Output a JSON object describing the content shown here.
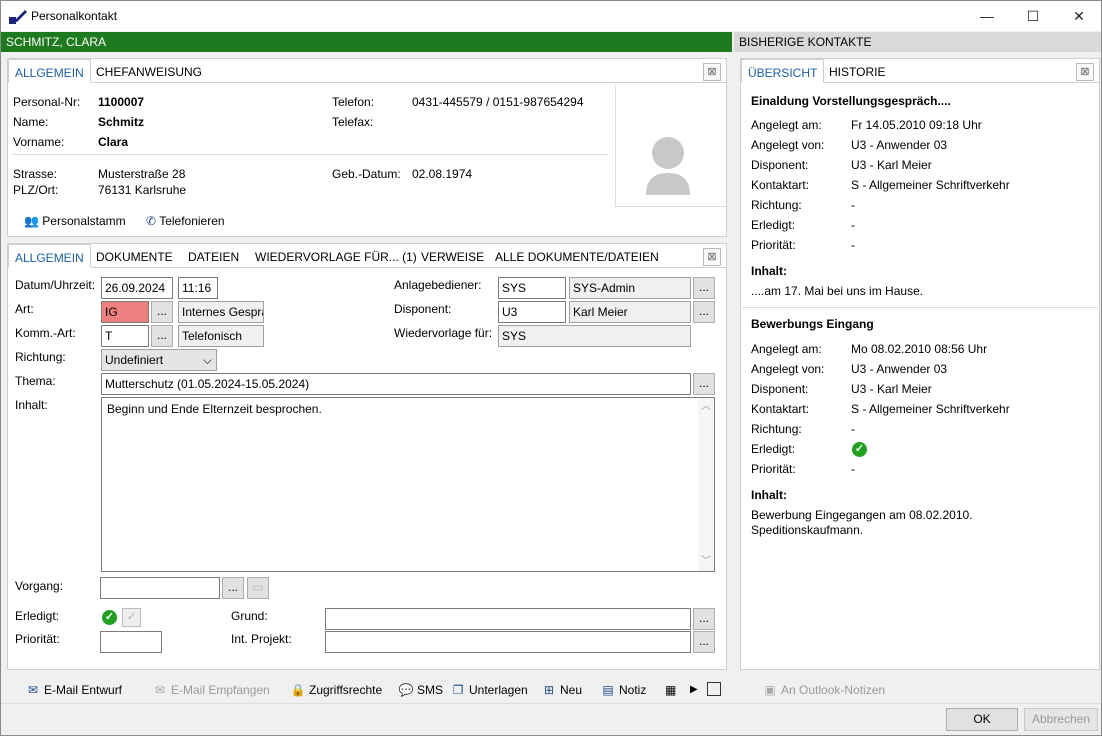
{
  "window": {
    "title": "Personalkontakt",
    "minimize": "—",
    "maximize": "☐",
    "close": "✕"
  },
  "left_header": "SCHMITZ, CLARA",
  "right_header": "BISHERIGE KONTAKTE",
  "colors": {
    "green_header": "#1e7a1e",
    "grey_header": "#d9d9d9",
    "accent": "#1a5fb4",
    "art_highlight": "#f08080"
  },
  "top_tabs": [
    "ALLGEMEIN",
    "CHEFANWEISUNG"
  ],
  "person": {
    "personal_nr_label": "Personal-Nr:",
    "personal_nr": "1100007",
    "name_label": "Name:",
    "name": "Schmitz",
    "vorname_label": "Vorname:",
    "vorname": "Clara",
    "telefon_label": "Telefon:",
    "telefon": "0431-445579 / 0151-987654294",
    "telefax_label": "Telefax:",
    "telefax": "",
    "strasse_label": "Strasse:",
    "strasse": "Musterstraße 28",
    "plz_label": "PLZ/Ort:",
    "plz": "76131 Karlsruhe",
    "geb_label": "Geb.-Datum:",
    "geb": "02.08.1974"
  },
  "actions": {
    "personalstamm": "Personalstamm",
    "telefonieren": "Telefonieren"
  },
  "form_tabs": [
    "ALLGEMEIN",
    "DOKUMENTE",
    "DATEIEN",
    "WIEDERVORLAGE FÜR... (1)",
    "VERWEISE",
    "ALLE DOKUMENTE/DATEIEN"
  ],
  "form": {
    "datum_label": "Datum/Uhrzeit:",
    "datum": "26.09.2024",
    "uhrzeit": "11:16",
    "art_label": "Art:",
    "art_code": "IG",
    "art_text": "Internes Gesprä",
    "komm_label": "Komm.-Art:",
    "komm_code": "T",
    "komm_text": "Telefonisch",
    "richtung_label": "Richtung:",
    "richtung": "Undefiniert",
    "thema_label": "Thema:",
    "thema": "Mutterschutz (01.05.2024-15.05.2024)",
    "inhalt_label": "Inhalt:",
    "inhalt": "Beginn und Ende Elternzeit besprochen.",
    "anlage_label": "Anlagebediener:",
    "anlage_code": "SYS",
    "anlage_text": "SYS-Admin",
    "disponent_label": "Disponent:",
    "disponent_code": "U3",
    "disponent_text": "Karl Meier",
    "wiedervorlage_label": "Wiedervorlage für:",
    "wiedervorlage": "SYS",
    "vorgang_label": "Vorgang:",
    "vorgang": "",
    "erledigt_label": "Erledigt:",
    "prioritaet_label": "Priorität:",
    "prioritaet": "",
    "grund_label": "Grund:",
    "grund": "",
    "projekt_label": "Int. Projekt:",
    "projekt": "",
    "dots": "..."
  },
  "toolbar": [
    {
      "label": "E-Mail Entwurf",
      "icon": "email-draft-icon",
      "glyph": "✉",
      "enabled": true
    },
    {
      "label": "E-Mail Empfangen",
      "icon": "email-received-icon",
      "glyph": "✉",
      "enabled": false
    },
    {
      "label": "Zugriffsrechte",
      "icon": "lock-icon",
      "glyph": "🔒",
      "enabled": true
    },
    {
      "label": "SMS",
      "icon": "sms-icon",
      "glyph": "💬",
      "enabled": true
    },
    {
      "label": "Unterlagen",
      "icon": "documents-icon",
      "glyph": "❐",
      "enabled": true
    },
    {
      "label": "Neu",
      "icon": "new-icon",
      "glyph": "⊞",
      "enabled": true
    },
    {
      "label": "Notiz",
      "icon": "note-icon",
      "glyph": "▤",
      "enabled": true
    }
  ],
  "outlook": "An Outlook-Notizen",
  "right_tabs": [
    "ÜBERSICHT",
    "HISTORIE"
  ],
  "labels": {
    "angelegt_am": "Angelegt am:",
    "angelegt_von": "Angelegt von:",
    "disponent": "Disponent:",
    "kontaktart": "Kontaktart:",
    "richtung": "Richtung:",
    "erledigt": "Erledigt:",
    "prioritaet": "Priorität:",
    "inhalt": "Inhalt:"
  },
  "history": [
    {
      "title": "Einaldung Vorstellungsgespräch....",
      "angelegt_am": "Fr 14.05.2010 09:18 Uhr",
      "angelegt_von": "U3 - Anwender 03",
      "disponent": "U3 - Karl Meier",
      "kontaktart": "S - Allgemeiner Schriftverkehr",
      "richtung": "-",
      "erledigt": "-",
      "prioritaet": "-",
      "inhalt": "....am 17. Mai bei uns im Hause.",
      "inhalt2": ""
    },
    {
      "title": "Bewerbungs Eingang",
      "angelegt_am": "Mo 08.02.2010 08:56 Uhr",
      "angelegt_von": "U3 - Anwender 03",
      "disponent": "U3 - Karl Meier",
      "kontaktart": "S - Allgemeiner Schriftverkehr",
      "richtung": "-",
      "erledigt": "",
      "prioritaet": "-",
      "inhalt": "Bewerbung Eingegangen am 08.02.2010.",
      "inhalt2": "Speditionskaufmann."
    }
  ],
  "buttons": {
    "ok": "OK",
    "abbrechen": "Abbrechen"
  }
}
